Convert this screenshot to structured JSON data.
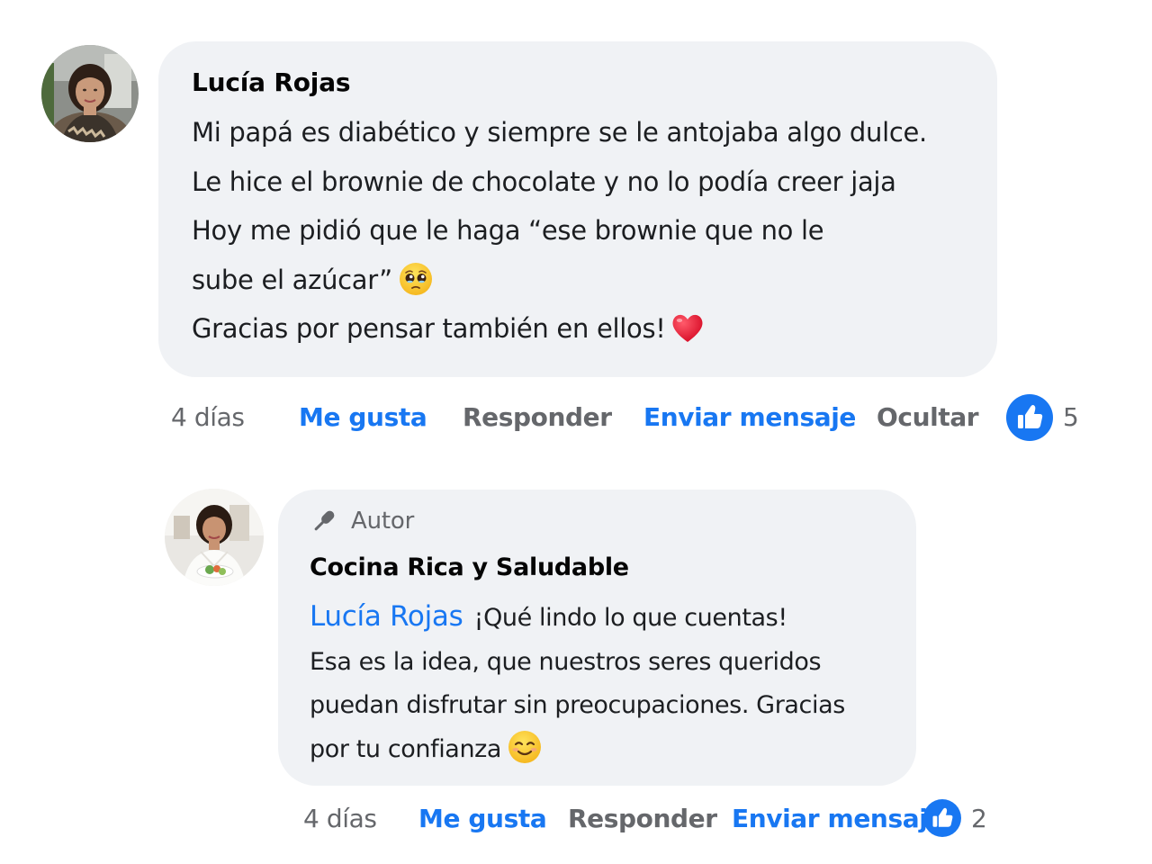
{
  "comment": {
    "author": "Lucía Rojas",
    "lines": [
      "Mi papá es diabético y siempre se le antojaba algo dulce.",
      "Le hice el brownie de chocolate y no lo podía creer jaja",
      "Hoy me pidió que le haga “ese brownie que no le",
      "sube el azúcar”",
      "Gracias por pensar también en ellos!"
    ],
    "emoji_after_line_4": "pleading-face-emoji",
    "emoji_after_line_5": "red-heart-emoji",
    "actions": {
      "time": "4 días",
      "like": "Me gusta",
      "reply": "Responder",
      "message": "Enviar mensaje",
      "hide": "Ocultar"
    },
    "reaction_count": "5",
    "reaction_icon": "thumbs-up-icon"
  },
  "reply": {
    "badge_label": "Autor",
    "badge_icon": "microphone-icon",
    "page_name": "Cocina Rica y Saludable",
    "mention": "Lucía Rojas",
    "first_line": "¡Qué lindo lo que cuentas!",
    "lines": [
      "Esa es la idea, que nuestros seres queridos",
      "puedan disfrutar sin preocupaciones. Gracias",
      "por tu confianza"
    ],
    "emoji_after_last_line": "smiling-face-emoji",
    "actions": {
      "time": "4 días",
      "like": "Me gusta",
      "reply": "Responder",
      "message": "Enviar mensaje"
    },
    "reaction_count": "2",
    "reaction_icon": "thumbs-up-icon"
  },
  "colors": {
    "link_blue": "#1877f2",
    "muted_gray": "#65676b",
    "bubble_bg": "#f0f2f5",
    "text": "#1c1e21"
  }
}
